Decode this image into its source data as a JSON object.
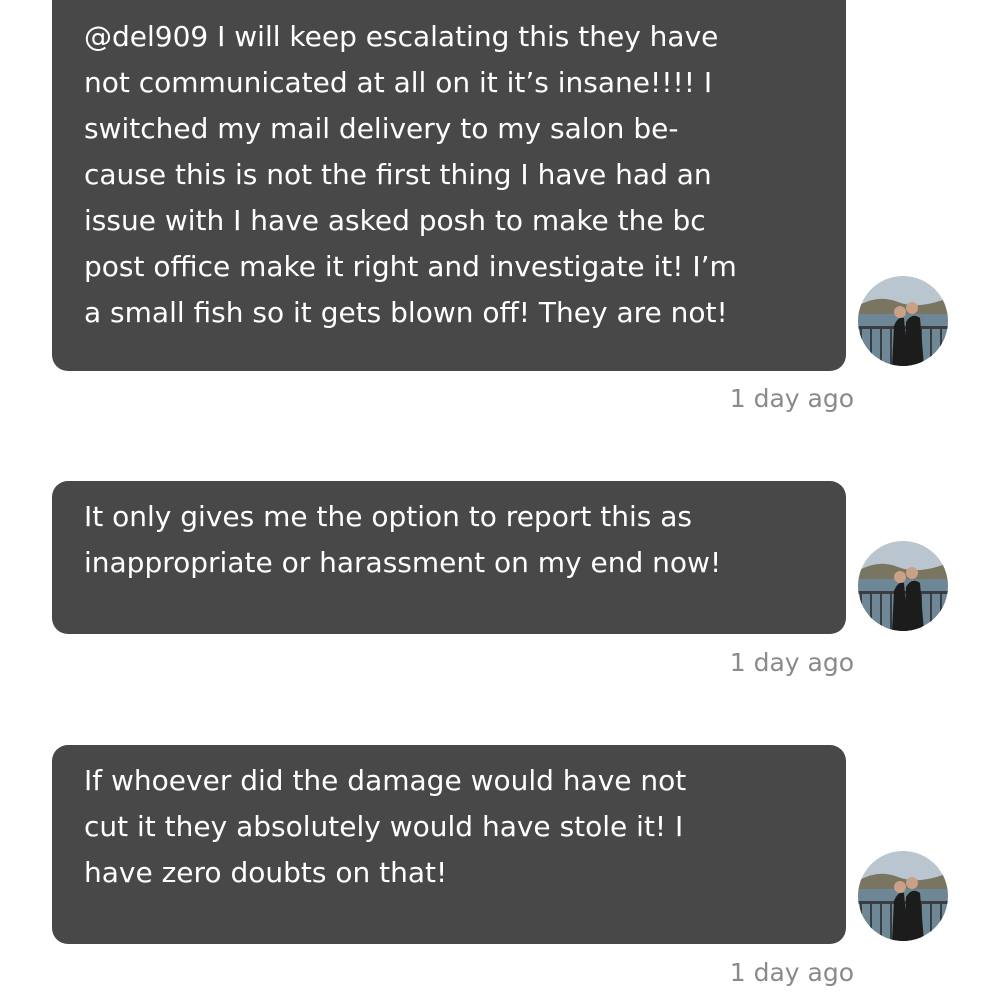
{
  "messages": [
    {
      "lines": [
        "@del909 I will keep escalating this they have",
        "not communicated at all on it it’s insane!!!! I",
        "switched my mail delivery to my salon be-",
        "cause this is not the first thing I have had an",
        "issue with I have asked posh to make the bc",
        "post office make it right and investigate it! I’m",
        "a small fish so it gets blown off! They are not!"
      ],
      "timestamp": "1 day ago"
    },
    {
      "lines": [
        "It only gives me the option to report this as",
        "inappropriate or harassment on my end now!"
      ],
      "timestamp": "1 day ago"
    },
    {
      "lines": [
        "If whoever did the damage would have not",
        "cut it they absolutely would have stole it! I",
        "have zero doubts on that!"
      ],
      "timestamp": "1 day ago"
    }
  ],
  "avatar": {
    "icon": "user-avatar-photo",
    "colors": {
      "sky": "#b9c6cf",
      "water": "#6d8796",
      "hills": "#7a7560",
      "figure": "#1c1c1c",
      "skin": "#c9a189",
      "railing": "#3a3d40"
    }
  },
  "colors": {
    "bubble": "#484848",
    "bubble_text": "#ffffff",
    "timestamp": "#8a8a8a",
    "background": "#ffffff"
  }
}
